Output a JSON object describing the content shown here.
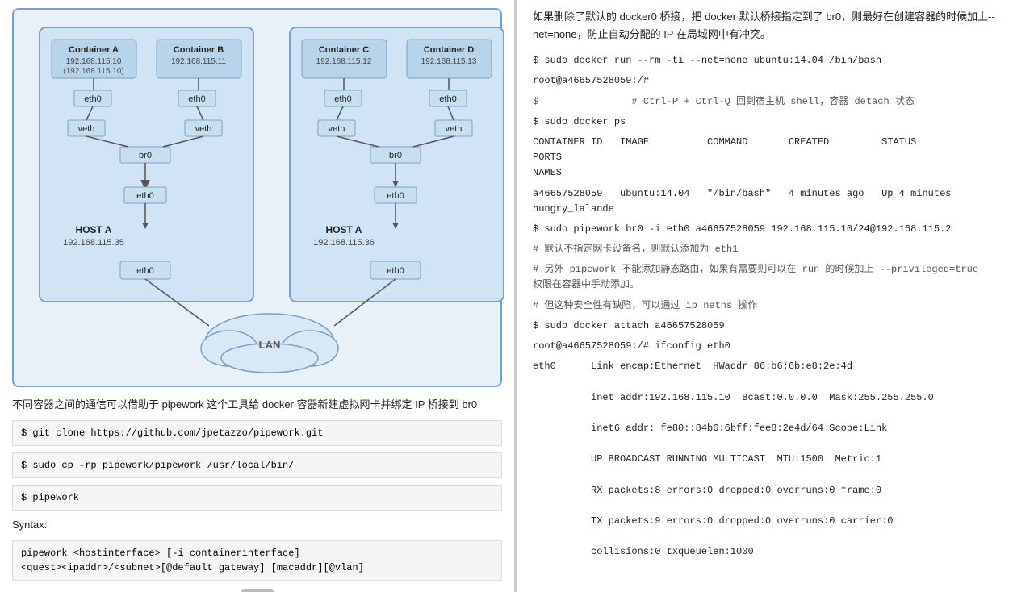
{
  "diagram": {
    "host_a_left": {
      "label": "HOST A",
      "ip": "192.168.115.35",
      "eth": "eth0",
      "containers": [
        {
          "name": "Container A",
          "ip": "192.168.115.10"
        },
        {
          "name": "Container B",
          "ip": "192.168.115.11"
        }
      ],
      "eth_items": [
        "eth0",
        "eth0"
      ],
      "veth_items": [
        "veth",
        "veth"
      ],
      "br": "br0"
    },
    "host_a_right": {
      "label": "HOST A",
      "ip": "192.168.115.36",
      "eth": "eth0",
      "containers": [
        {
          "name": "Container C",
          "ip": "192.168.115.12"
        },
        {
          "name": "Container D",
          "ip": "192.168.115.13"
        }
      ],
      "eth_items": [
        "eth0",
        "eth0"
      ],
      "veth_items": [
        "veth",
        "veth"
      ],
      "br": "br0"
    },
    "lan_label": "LAN"
  },
  "left_text": {
    "description": "不同容器之间的通信可以借助于 pipework 这个工具给 docker 容器新建虚拟网卡并绑定 IP 桥接到 br0",
    "code1": "$ git clone https://github.com/jpetazzo/pipework.git",
    "code2": "$ sudo cp -rp pipework/pipework /usr/local/bin/",
    "code3": "$ pipework",
    "syntax_label": "Syntax:",
    "code4": "pipework <hostinterface> [-i containerinterface]\n<quest><ipaddr>/<subnet>[@default gateway] [macaddr][@vlan]"
  },
  "right_text": {
    "intro": "如果删除了默认的 docker0 桥接，把 docker 默认桥接指定到了 br0，则最好在创建容器的时候加上--net=none，防止自动分配的 IP 在局域网中有冲突。",
    "cmd1": "$ sudo docker run --rm -ti --net=none ubuntu:14.04 /bin/bash",
    "cmd2": "root@a46657528059:/#",
    "cmd3": "$                # Ctrl-P + Ctrl-Q 回到宿主机 shell，容器 detach 状态",
    "cmd4": "$ sudo docker ps",
    "table_header": "CONTAINER ID   IMAGE          COMMAND       CREATED         STATUS          PORTS\nNAMES",
    "table_row": "a46657528059   ubuntu:14.04   \"/bin/bash\"   4 minutes ago   Up 4 minutes\nhungry_lalande",
    "cmd5": "$ sudo pipework br0 -i eth0 a46657528059 192.168.115.10/24@192.168.115.2",
    "comment1": "# 默认不指定网卡设备名，则默认添加为 eth1",
    "comment2": "# 另外 pipework 不能添加静态路由，如果有需要则可以在 run 的时候加上 --privileged=true\n权限在容器中手动添加。",
    "comment3": "# 但这种安全性有缺陷，可以通过 ip netns 操作",
    "cmd6": "$ sudo docker attach a46657528059",
    "cmd7": "root@a46657528059:/# ifconfig eth0",
    "eth0_section": "eth0      Link encap:Ethernet  HWaddr 86:b6:6b:e8:2e:4d\n\n          inet addr:192.168.115.10  Bcast:0.0.0.0  Mask:255.255.255.0\n\n          inet6 addr: fe80::84b6:6bff:fee8:2e4d/64 Scope:Link\n\n          UP BROADCAST RUNNING MULTICAST  MTU:1500  Metric:1\n\n          RX packets:8 errors:0 dropped:0 overruns:0 frame:0\n\n          TX packets:9 errors:0 dropped:0 overruns:0 carrier:0\n\n          collisions:0 txqueuelen:1000"
  }
}
